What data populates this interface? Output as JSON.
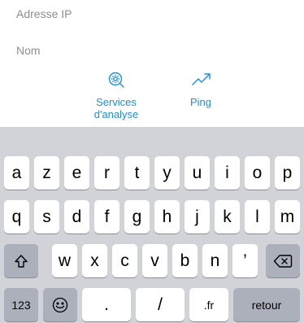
{
  "fields": {
    "ip_placeholder": "Adresse IP",
    "name_placeholder": "Nom"
  },
  "actions": [
    {
      "icon": "scan-services-icon",
      "label_line1": "Services",
      "label_line2": "d'analyse"
    },
    {
      "icon": "trend-chart-icon",
      "label": "Ping"
    }
  ],
  "keyboard": {
    "row1": [
      "a",
      "z",
      "e",
      "r",
      "t",
      "y",
      "u",
      "i",
      "o",
      "p"
    ],
    "row2": [
      "q",
      "s",
      "d",
      "f",
      "g",
      "h",
      "j",
      "k",
      "l",
      "m"
    ],
    "row3": [
      "w",
      "x",
      "c",
      "v",
      "b",
      "n",
      "’"
    ],
    "bottom": {
      "numbers": "123",
      "emoji_icon": "emoji-icon",
      "dot": ".",
      "slash": "/",
      "tld": ".fr",
      "return": "retour"
    },
    "shift_icon": "shift-icon",
    "backspace_icon": "backspace-icon"
  },
  "colors": {
    "accent": "#1a8fd8",
    "placeholder": "#8e8e93",
    "keyboard_bg": "#d1d3d9",
    "key_gray": "#abb0ba"
  }
}
